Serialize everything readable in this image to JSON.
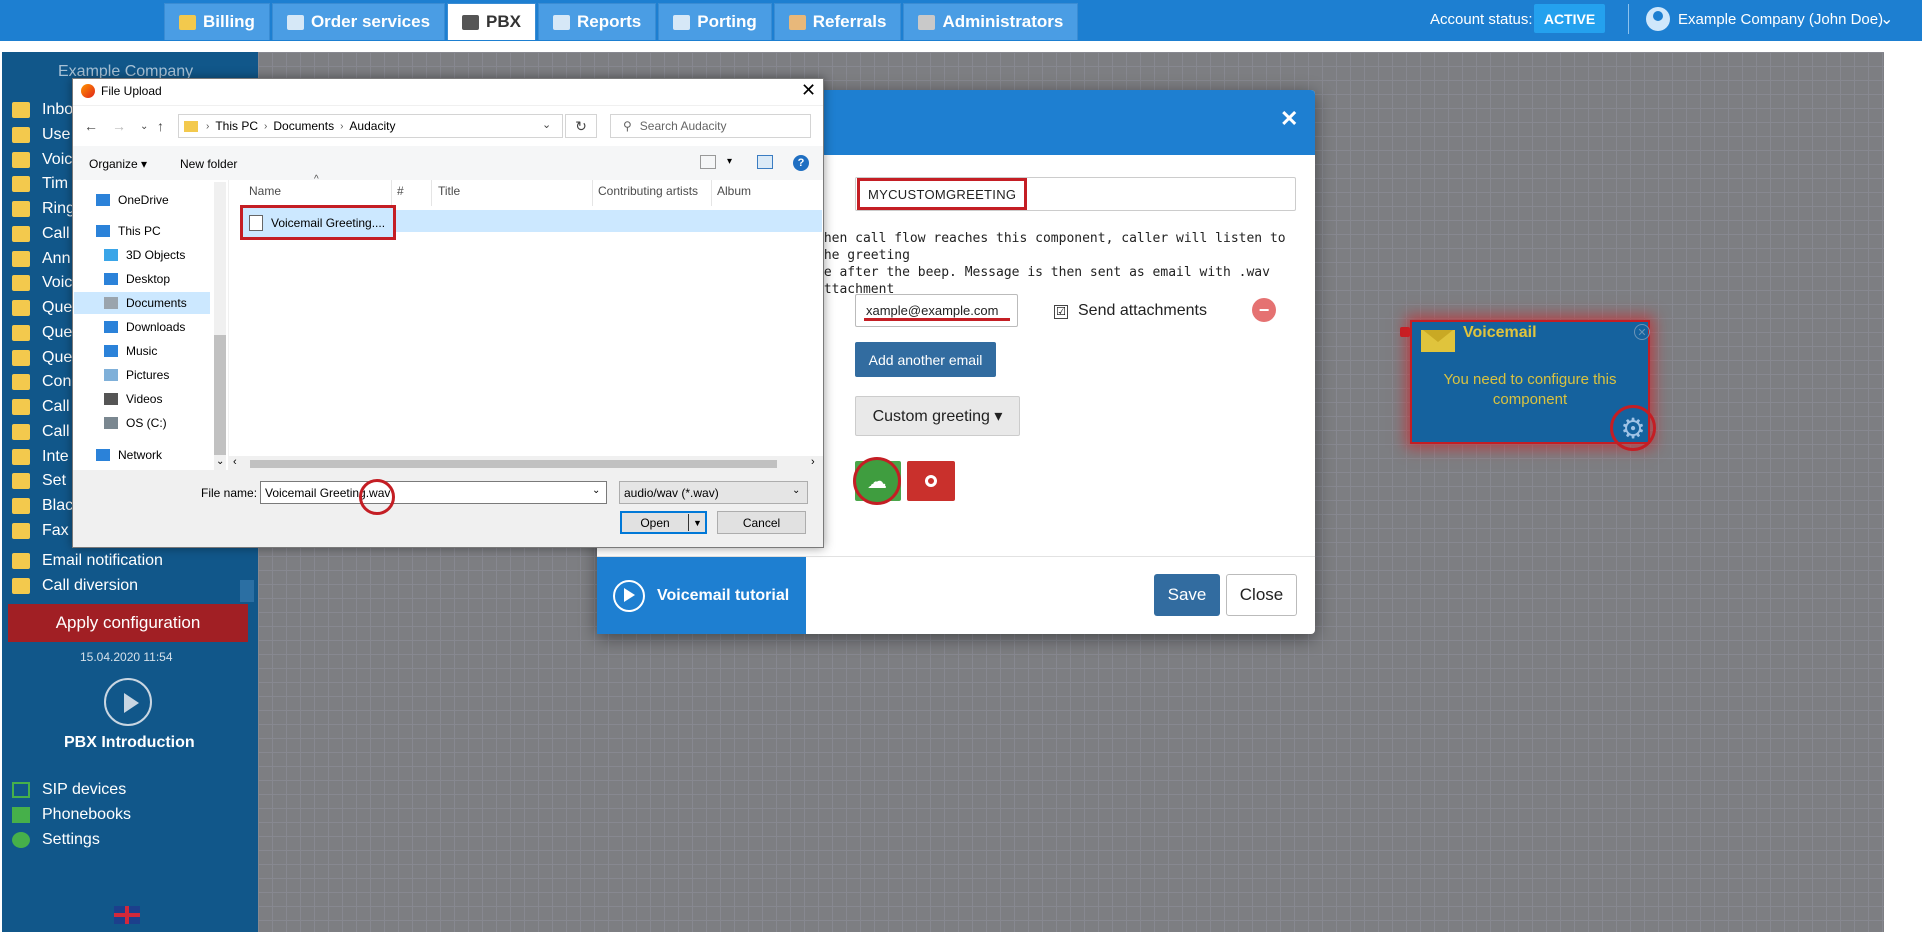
{
  "nav": {
    "tabs": [
      {
        "label": "Billing",
        "icon": "coins-icon"
      },
      {
        "label": "Order services",
        "icon": "cart-icon"
      },
      {
        "label": "PBX",
        "icon": "pbx-icon"
      },
      {
        "label": "Reports",
        "icon": "reports-icon"
      },
      {
        "label": "Porting",
        "icon": "porting-icon"
      },
      {
        "label": "Referrals",
        "icon": "referrals-icon"
      },
      {
        "label": "Administrators",
        "icon": "admin-icon"
      }
    ],
    "active_tab": "PBX",
    "account_status_label": "Account status:",
    "account_status_value": "ACTIVE",
    "user_name": "Example Company (John Doe)",
    "active_color": "#24a1ee"
  },
  "sidebar": {
    "company": "Example Company",
    "items": [
      "Inbo",
      "Use",
      "Voic",
      "Tim",
      "Ring",
      "Call",
      "Ann",
      "Voic",
      "Que",
      "Que",
      "Que",
      "Con",
      "Call",
      "Call",
      "Inte",
      "Set",
      "Blac",
      "Fax",
      "Email notification",
      "Call diversion"
    ],
    "apply_label": "Apply configuration",
    "timestamp": "15.04.2020 11:54",
    "intro_label": "PBX Introduction",
    "bottom_items": [
      "SIP devices",
      "Phonebooks",
      "Settings"
    ]
  },
  "component": {
    "title": "Voicemail",
    "message": "You need to configure this component"
  },
  "modal": {
    "greeting_name": "MYCUSTOMGREETING",
    "description_line1": "When call flow reaches this component, caller will listen to the greeting",
    "description_line2": "ge after the beep. Message is then sent as email with .wav attachment",
    "email_value": "xample@example.com",
    "send_attachments_label": "Send attachments",
    "check_mark": "☑",
    "add_email_label": "Add another email",
    "greeting_dropdown_label": "Custom greeting ▾",
    "tutorial_label": "Voicemail tutorial",
    "save_label": "Save",
    "close_label": "Close",
    "header_color": "#1e7fd1"
  },
  "file_dialog": {
    "title": "File Upload",
    "path": [
      "This PC",
      "Documents",
      "Audacity"
    ],
    "search_placeholder": "Search Audacity",
    "organize_label": "Organize ▾",
    "new_folder_label": "New folder",
    "nav_items": [
      {
        "label": "OneDrive",
        "icon": "cloud-icon"
      },
      {
        "label": "This PC",
        "icon": "computer-icon"
      },
      {
        "label": "3D Objects",
        "icon": "cube-icon"
      },
      {
        "label": "Desktop",
        "icon": "desktop-icon"
      },
      {
        "label": "Documents",
        "icon": "document-icon"
      },
      {
        "label": "Downloads",
        "icon": "download-icon"
      },
      {
        "label": "Music",
        "icon": "music-icon"
      },
      {
        "label": "Pictures",
        "icon": "pictures-icon"
      },
      {
        "label": "Videos",
        "icon": "video-icon"
      },
      {
        "label": "OS (C:)",
        "icon": "drive-icon"
      },
      {
        "label": "Network",
        "icon": "network-icon"
      }
    ],
    "columns": [
      "Name",
      "#",
      "Title",
      "Contributing artists",
      "Album"
    ],
    "file_name_display": "Voicemail Greeting....",
    "file_name_label": "File name:",
    "file_name_value": "Voicemail Greeting.wav",
    "file_type": "audio/wav (*.wav)",
    "open_label": "Open",
    "cancel_label": "Cancel"
  }
}
